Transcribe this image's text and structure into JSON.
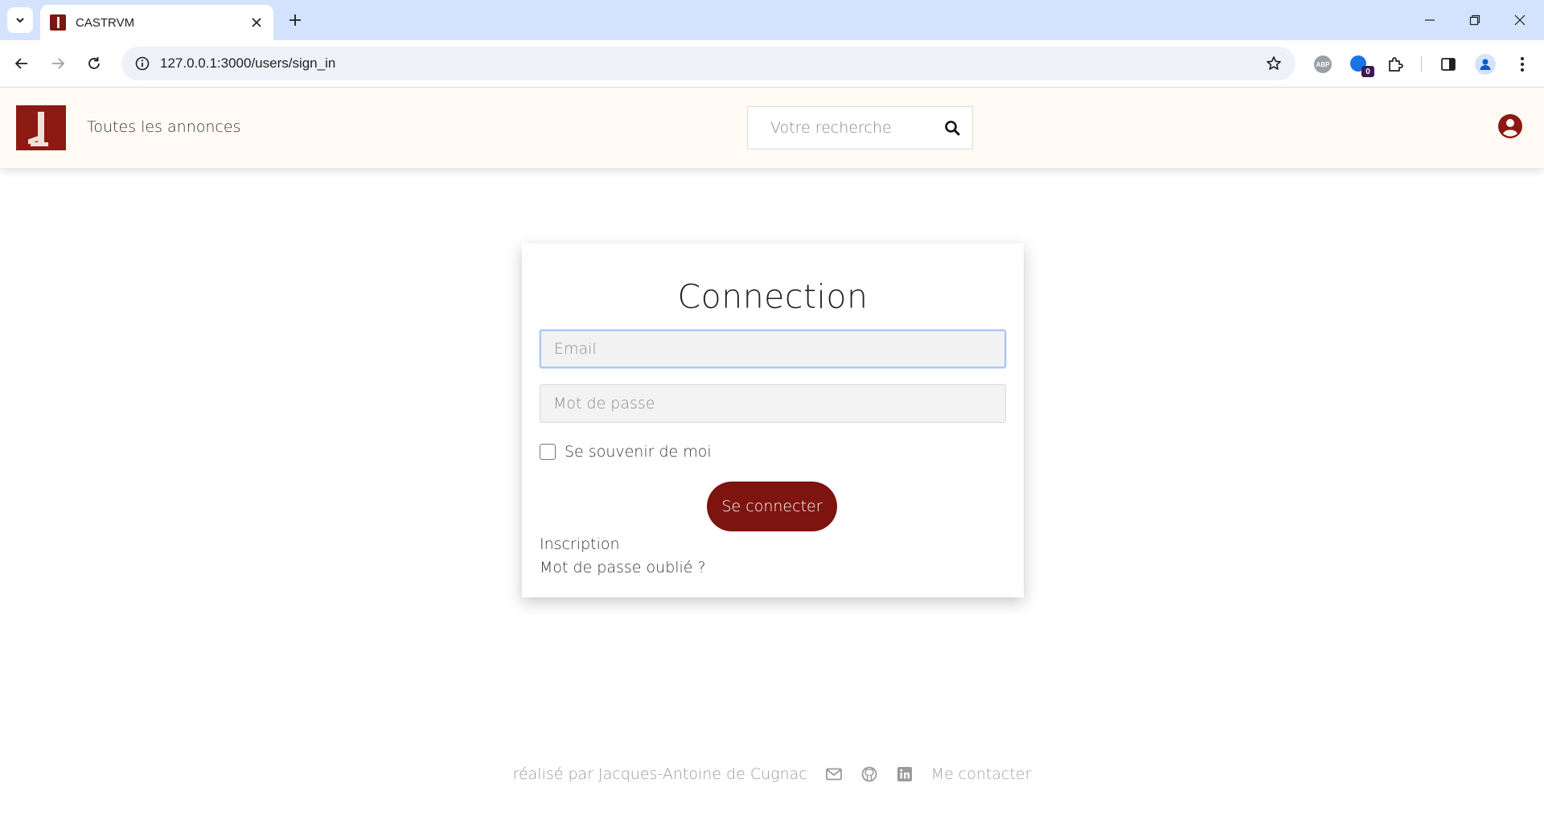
{
  "browser": {
    "tab_title": "CASTRVM",
    "url": "127.0.0.1:3000/users/sign_in",
    "extension_badge": "0",
    "abp_label": "ABP"
  },
  "navbar": {
    "link_label": "Toutes les annonces",
    "search_placeholder": "Votre recherche"
  },
  "login": {
    "title": "Connection",
    "email_placeholder": "Email",
    "password_placeholder": "Mot de passe",
    "remember_label": "Se souvenir de moi",
    "submit_label": "Se connecter",
    "links": [
      "Inscription",
      "Mot de passe oublié ?"
    ]
  },
  "footer": {
    "credit": "réalisé par Jacques-Antoine de Cugnac",
    "contact_label": "Me contacter",
    "icons": [
      "envelope-icon",
      "github-icon",
      "linkedin-icon"
    ]
  },
  "colors": {
    "brand": "#7d1410",
    "navbar_bg": "#fffbf4",
    "focus_ring": "#a8c7fa"
  }
}
